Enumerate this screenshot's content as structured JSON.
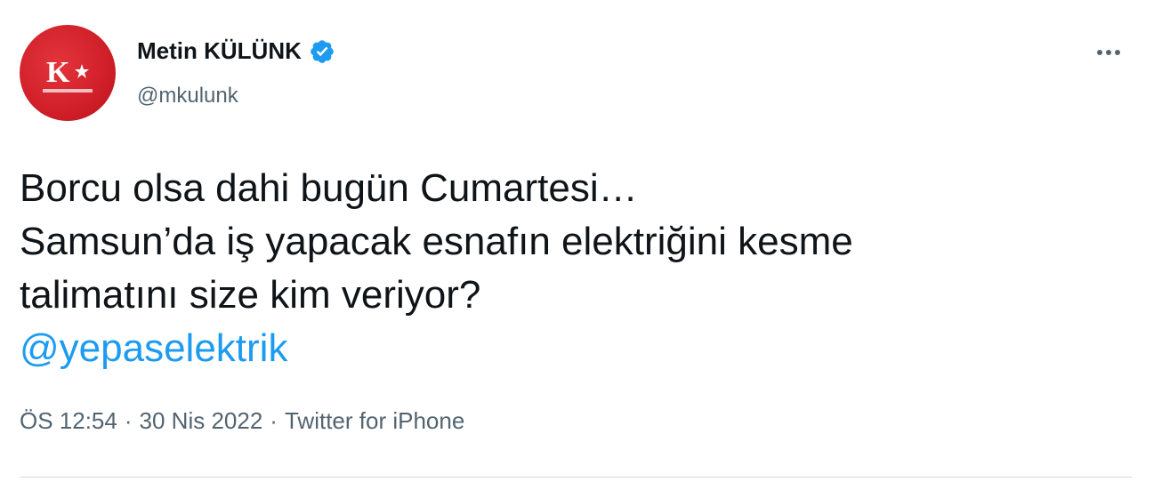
{
  "tweet": {
    "author": {
      "display_name": "Metin KÜLÜNK",
      "handle": "@mkulunk",
      "verified": true,
      "avatar_icon": "profile-logo-icon"
    },
    "more_icon": "more-horizontal-icon",
    "text_lines": [
      "Borcu olsa dahi bugün Cumartesi…",
      "Samsun’da iş yapacak esnafın elektriğini kesme",
      "talimatını size kim veriyor?"
    ],
    "mention": "@yepaselektrik",
    "meta": {
      "time": "ÖS 12:54",
      "separator": "·",
      "date": "30 Nis 2022",
      "source": "Twitter for iPhone"
    }
  },
  "colors": {
    "text": "#0f1419",
    "secondary": "#536471",
    "link": "#1d9bf0",
    "verified": "#1d9bf0",
    "avatar": "#d01f28",
    "divider": "#cfd9de"
  }
}
